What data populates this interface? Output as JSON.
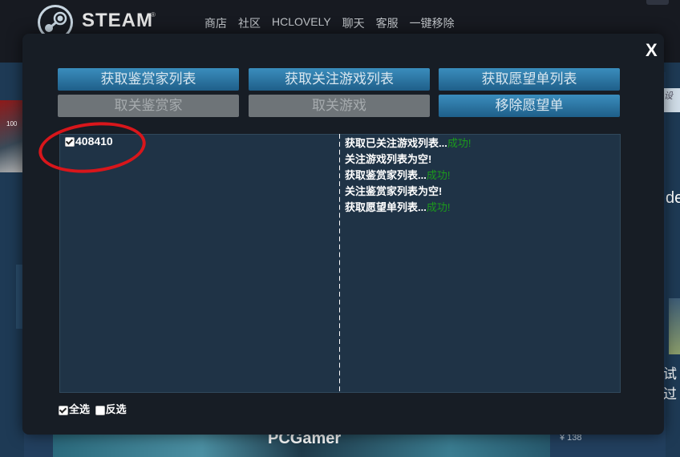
{
  "header": {
    "logo_text": "STEAM",
    "logo_reg": "®",
    "nav": [
      "商店",
      "社区",
      "HCLOVELY",
      "聊天",
      "客服",
      "一键移除"
    ]
  },
  "background": {
    "badge": "100",
    "right_panel_text": "设",
    "right_text_top": "de",
    "right_text_bottom": "试过",
    "price": "¥ 138",
    "banner_text": "PCGamer"
  },
  "modal": {
    "close_label": "X",
    "buttons_row1": [
      "获取鉴赏家列表",
      "获取关注游戏列表",
      "获取愿望单列表"
    ],
    "buttons_row2": [
      "取关鉴赏家",
      "取关游戏",
      "移除愿望单"
    ],
    "list": [
      {
        "id": "408410",
        "checked": true
      }
    ],
    "log": [
      {
        "text": "获取已关注游戏列表...",
        "status": "成功!"
      },
      {
        "text": "关注游戏列表为空!",
        "status": ""
      },
      {
        "text": "获取鉴赏家列表...",
        "status": "成功!"
      },
      {
        "text": "关注鉴赏家列表为空!",
        "status": ""
      },
      {
        "text": "获取愿望单列表...",
        "status": "成功!"
      }
    ],
    "select_all": {
      "label": "全选",
      "checked": true
    },
    "invert": {
      "label": "反选",
      "checked": false
    }
  },
  "colors": {
    "accent_button": "#2a75a5",
    "success": "#1c9a1c",
    "highlight_circle": "#d8161b"
  }
}
